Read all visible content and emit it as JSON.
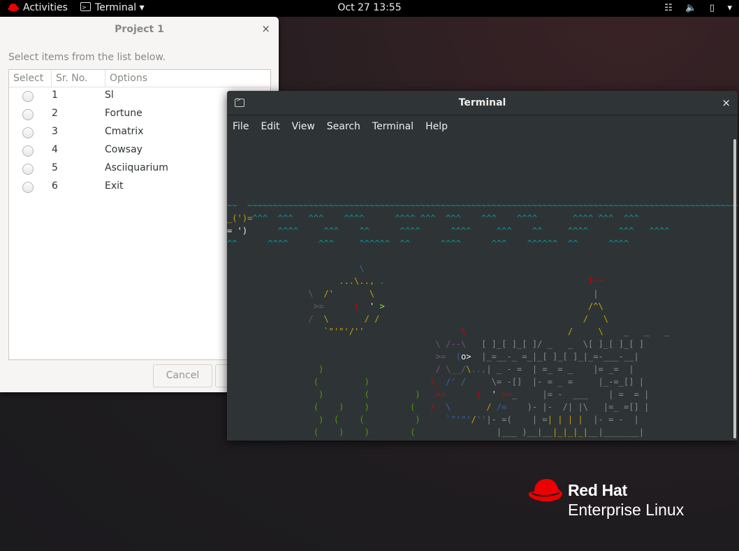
{
  "topbar": {
    "activities": "Activities",
    "app_menu": "Terminal ▾",
    "clock": "Oct 27  13:55",
    "tray": {
      "network": "⧖",
      "volume": "🔊",
      "battery": "▮",
      "menu": "▾"
    }
  },
  "dialog": {
    "title": "Project 1",
    "close": "×",
    "label": "Select items from the list below.",
    "columns": [
      "Select",
      "Sr. No.",
      "Options"
    ],
    "rows": [
      {
        "num": "1",
        "option": "Sl"
      },
      {
        "num": "2",
        "option": "Fortune"
      },
      {
        "num": "3",
        "option": "Cmatrix"
      },
      {
        "num": "4",
        "option": "Cowsay"
      },
      {
        "num": "5",
        "option": "Asciiquarium"
      },
      {
        "num": "6",
        "option": "Exit"
      }
    ],
    "cancel": "Cancel"
  },
  "terminal": {
    "title": "Terminal",
    "close": "×",
    "menu": [
      "File",
      "Edit",
      "View",
      "Search",
      "Terminal",
      "Help"
    ]
  },
  "brand": {
    "name": "Red Hat",
    "product": "Enterprise Linux"
  },
  "colors": {
    "brand_red": "#ee0000",
    "terminal_bg": "#2e3436"
  }
}
